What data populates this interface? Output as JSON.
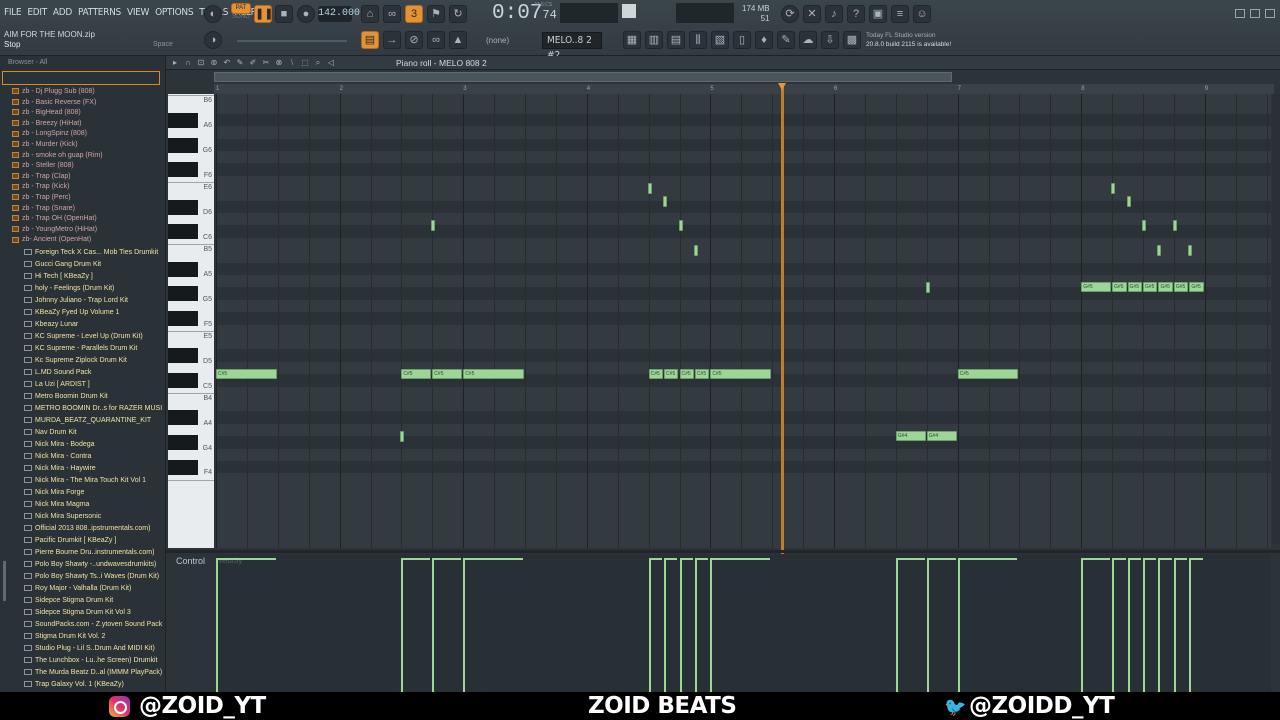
{
  "menu": [
    "FILE",
    "EDIT",
    "ADD",
    "PATTERNS",
    "VIEW",
    "OPTIONS",
    "TOOLS",
    "HELP"
  ],
  "transport": {
    "pat_label": "PAT",
    "song_label": "SONG",
    "tempo": "142.000",
    "time_main": "0:07",
    "time_frac": "74",
    "time_unit": "M:S:CS"
  },
  "memory": {
    "value": "174 MB",
    "voices": "51"
  },
  "hint": {
    "file": "AIM FOR THE MOON.zip",
    "status": "Stop",
    "shortcut": "Space"
  },
  "toolbar": {
    "snap": "(none)",
    "pattern": "MELO..8 2 #2"
  },
  "news": {
    "line1": "Today  FL Studio version",
    "line2": "20.8.0 build 2115 is available!"
  },
  "browser": {
    "header": "Browser - All",
    "items_a": [
      "zb - Dj Plugg Sub (808)",
      "zb - Basic Reverse (FX)",
      "zb - BigHead (808)",
      "zb - Breezy (HiHat)",
      "zb - LongSpinz (808)",
      "zb - Murder (Kick)",
      "zb - smoke oh guap (Rim)",
      "zb - Steller (808)",
      "zb - Trap (Clap)",
      "zb - Trap (Kick)",
      "zb - Trap (Perc)",
      "zb - Trap (Snare)",
      "zb - Trap OH (OpenHat)",
      "zb - YoungMetro (HiHat)",
      "zb- Ancient (OpenHat)"
    ],
    "items_b": [
      "Foreign Teck X Cas... Mob Ties Drumkit",
      "Gucci Gang Drum Kit",
      "Hi Tech [ KBeaZy ]",
      "holy - Feelings (Drum Kit)",
      "Johnny Juliano - Trap Lord Kit",
      "KBeaZy Fyed Up Volume 1",
      "Kbeazy Lunar",
      "KC Supreme - Level Up (Drum Kit)",
      "KC Supreme - Parallels Drum Kit",
      "Kc Supreme Ziplock Drum Kit",
      "L.MD Sound Pack",
      "La Uzi [ ARDIST ]",
      "Metro Boomin Drum Kit",
      "METRO BOOMIN Dr..s for RAZER MUSIC",
      "MURDA_BEATZ_QUARANTINE_KIT",
      "Nav Drum Kit",
      "Nick Mira - Bodega",
      "Nick Mira - Contra",
      "Nick Mira - Haywire",
      "Nick Mira - The Mira Touch Kit Vol 1",
      "Nick Mira Forge",
      "Nick Mira Magma",
      "Nick Mira Supersonic",
      "Official 2013 808..ipstrumentals.com)",
      "Pacific Drumkit [ KBeaZy ]",
      "Pierre Bourne Dru..instrumentals.com)",
      "Polo Boy Shawty -..undwavesdrumkits)",
      "Polo Boy Shawty Ts..i Waves (Drum Kit)",
      "Roy Major - Valhalla (Drum Kit)",
      "Sidepce Stigma Drum Kit",
      "Sidepce Stigma Drum Kit Vol 3",
      "SoundPacks.com - Z.ytoven Sound Pack",
      "Stigma Drum Kit Vol. 2",
      "Studio Plug - Lil S..Drum And MIDI Kit)",
      "The Lunchbox - Lu..he Screen) Drumkit",
      "The Murda Beatz D..al (IMMM PlayPack)",
      "Trap Galaxy Vol. 1 (KBeaZy)"
    ]
  },
  "piano_roll": {
    "title": "Piano roll - MELO 808 2",
    "bars": [
      "1",
      "2",
      "3",
      "4",
      "5",
      "6",
      "7",
      "8",
      "9"
    ],
    "key_labels": [
      "B6",
      "A6",
      "G6",
      "F6",
      "E6",
      "D6",
      "C6",
      "B5",
      "A5",
      "G5",
      "F5",
      "E5",
      "D5",
      "C5",
      "B4",
      "A4",
      "G4",
      "F4"
    ],
    "control_label": "Control",
    "velocity_label": "Velocity",
    "notes": [
      {
        "bar": 1.0,
        "len": 0.5,
        "pitch": "C#5",
        "label": "C#5"
      },
      {
        "bar": 2.5,
        "len": 0.25,
        "pitch": "C#5",
        "label": "C#5"
      },
      {
        "bar": 2.75,
        "len": 0.25,
        "pitch": "C#5",
        "label": "C#5"
      },
      {
        "bar": 3.0,
        "len": 0.5,
        "pitch": "C#5",
        "label": "C#5"
      },
      {
        "bar": 4.5,
        "len": 0.125,
        "pitch": "C#5",
        "label": "C#5"
      },
      {
        "bar": 4.625,
        "len": 0.125,
        "pitch": "C#5",
        "label": "C#5"
      },
      {
        "bar": 4.75,
        "len": 0.125,
        "pitch": "C#5",
        "label": "C#5"
      },
      {
        "bar": 4.875,
        "len": 0.125,
        "pitch": "C#5",
        "label": "C#5"
      },
      {
        "bar": 5.0,
        "len": 0.5,
        "pitch": "C#5",
        "label": "C#5"
      },
      {
        "bar": 7.0,
        "len": 0.5,
        "pitch": "C#5",
        "label": "C#5"
      },
      {
        "bar": 6.5,
        "len": 0.25,
        "pitch": "G#4",
        "label": "G#4"
      },
      {
        "bar": 6.75,
        "len": 0.25,
        "pitch": "G#4",
        "label": "G#4"
      },
      {
        "bar": 8.0,
        "len": 0.25,
        "pitch": "G#5",
        "label": "G#5"
      },
      {
        "bar": 8.25,
        "len": 0.125,
        "pitch": "G#5",
        "label": "G#5"
      },
      {
        "bar": 8.375,
        "len": 0.125,
        "pitch": "G#5",
        "label": "G#5"
      },
      {
        "bar": 8.5,
        "len": 0.125,
        "pitch": "G#5",
        "label": "G#5"
      },
      {
        "bar": 8.625,
        "len": 0.125,
        "pitch": "G#5",
        "label": "G#5"
      },
      {
        "bar": 8.75,
        "len": 0.125,
        "pitch": "G#5",
        "label": "G#5"
      },
      {
        "bar": 8.875,
        "len": 0.125,
        "pitch": "G#5",
        "label": "G#5"
      }
    ],
    "tiny_notes": [
      {
        "bar": 2.5,
        "pitch": "G#4"
      },
      {
        "bar": 2.75,
        "pitch": "C#6"
      },
      {
        "bar": 4.5,
        "pitch": "E6"
      },
      {
        "bar": 4.625,
        "pitch": "D#6"
      },
      {
        "bar": 4.75,
        "pitch": "C#6"
      },
      {
        "bar": 4.875,
        "pitch": "B5"
      },
      {
        "bar": 6.75,
        "pitch": "G#5"
      },
      {
        "bar": 8.25,
        "pitch": "E6"
      },
      {
        "bar": 8.375,
        "pitch": "D#6"
      },
      {
        "bar": 8.5,
        "pitch": "C#6"
      },
      {
        "bar": 8.625,
        "pitch": "B5"
      },
      {
        "bar": 8.75,
        "pitch": "C#6"
      },
      {
        "bar": 8.875,
        "pitch": "B5"
      }
    ],
    "playhead_bar": 5.57
  },
  "footer": {
    "instagram": "@ZOID_YT",
    "brand": "ZOID BEATS",
    "twitter": "@ZOIDD_YT"
  },
  "colors": {
    "accent": "#e59233",
    "note": "#9ed69a",
    "playhead": "#d98a2d"
  }
}
